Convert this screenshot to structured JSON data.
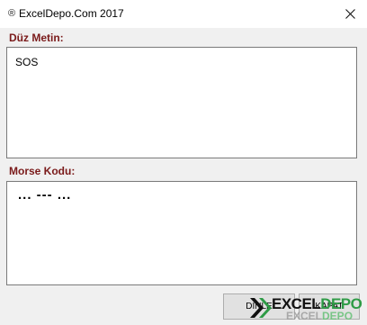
{
  "window": {
    "title": "ExcelDepo.Com 2017",
    "title_icon": "®",
    "close_icon": "close-icon"
  },
  "plain_text": {
    "label": "Düz Metin:",
    "value": "SOS"
  },
  "morse_code": {
    "label": "Morse Kodu:",
    "value": "... --- ..."
  },
  "buttons": {
    "listen_label": "DİNLE",
    "close_label": "KAPAT"
  },
  "watermark": {
    "brand_part1": "EXCEL",
    "brand_part2": "DEPO"
  }
}
